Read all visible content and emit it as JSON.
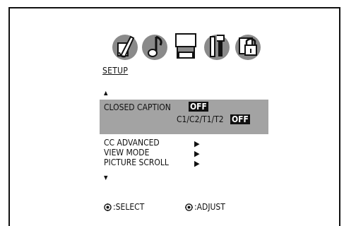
{
  "menu_icons": [
    {
      "name": "palette-icon"
    },
    {
      "name": "music-note-icon"
    },
    {
      "name": "tv-set-icon"
    },
    {
      "name": "tools-icon"
    },
    {
      "name": "lock-icon"
    }
  ],
  "title": "SETUP",
  "arrows": {
    "up": "▲",
    "down": "▼"
  },
  "closed_caption": {
    "label": "CLOSED CAPTION",
    "value": "OFF",
    "sub_label": "C1/C2/T1/T2",
    "sub_value": "OFF"
  },
  "menu_items": [
    {
      "label": "CC ADVANCED",
      "arrow": "▶"
    },
    {
      "label": "VIEW MODE",
      "arrow": "▶"
    },
    {
      "label": "PICTURE SCROLL",
      "arrow": "▶"
    }
  ],
  "footer": {
    "select_label": ":SELECT",
    "adjust_label": ":ADJUST"
  },
  "colors": {
    "highlight_bg": "#a3a3a3",
    "value_bg": "#111111",
    "icon_gray": "#8a8a8a"
  }
}
